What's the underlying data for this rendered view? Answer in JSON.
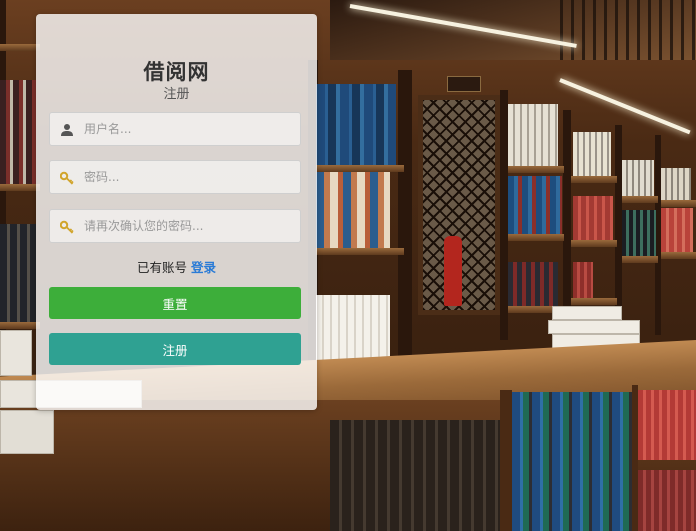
{
  "site": {
    "title": "借阅网",
    "subtitle": "注册"
  },
  "form": {
    "username": {
      "placeholder": "用户名...",
      "value": ""
    },
    "password": {
      "placeholder": "密码...",
      "value": ""
    },
    "confirm_password": {
      "placeholder": "请再次确认您的密码...",
      "value": ""
    },
    "has_account_text": "已有账号",
    "login_link": "登录",
    "reset_button": "重置",
    "register_button": "注册"
  },
  "colors": {
    "reset_button": "#3dae3a",
    "register_button": "#2fa192",
    "login_link": "#2a7bd6"
  },
  "icons": {
    "username": "user-icon",
    "password": "key-icon",
    "confirm_password": "key-icon"
  }
}
